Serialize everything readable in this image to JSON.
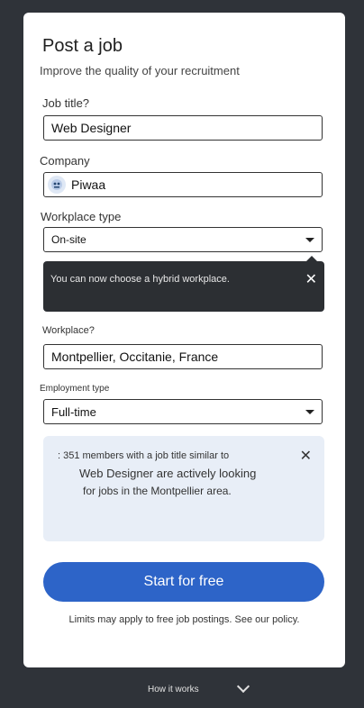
{
  "form": {
    "title": "Post a job",
    "subtitle": "Improve the quality of your recruitment",
    "job_title": {
      "label": "Job title?",
      "value": "Web Designer"
    },
    "company": {
      "label": "Company",
      "value": "Piwaa"
    },
    "workplace_type": {
      "label": "Workplace type",
      "value": "On-site"
    },
    "workplace": {
      "label": "Workplace?",
      "value": "Montpellier, Occitanie, France"
    },
    "employment_type": {
      "label": "Employment type",
      "value": "Full-time"
    }
  },
  "tooltip": {
    "text": "You can now choose a hybrid workplace.",
    "close": "✕"
  },
  "info": {
    "line1": ": 351 members with a job title similar to",
    "line2": "Web Designer are actively looking",
    "line3": "for jobs in the Montpellier area.",
    "close": "✕"
  },
  "cta_label": "Start for free",
  "note": "Limits may apply to free job postings. See our policy.",
  "footer": {
    "how_it_works": "How it works"
  },
  "colors": {
    "accent": "#2d64c8",
    "background": "#2f3339",
    "tooltip_bg": "#2c2f33",
    "info_bg": "#e8eef7"
  }
}
